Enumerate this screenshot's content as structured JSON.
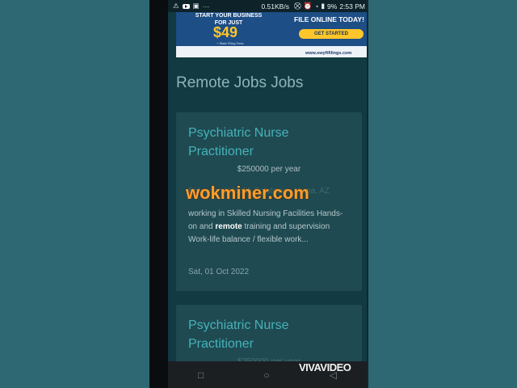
{
  "status_bar": {
    "speed": "0.51KB/s",
    "battery": "9%",
    "time": "2:53 PM"
  },
  "ad": {
    "line1": "START YOUR BUSINESS",
    "line2": "FOR JUST",
    "price": "$49",
    "fine_print": "+ State Filing Fees",
    "cta_title": "FILE ONLINE TODAY!",
    "cta_button": "GET STARTED",
    "url": "www.swyftfilings.com",
    "colors": {
      "background": "#1d4e86",
      "accent": "#ffc62b"
    }
  },
  "page": {
    "heading": "Remote Jobs Jobs"
  },
  "jobs": [
    {
      "title": "Psychiatric Nurse Practitioner",
      "salary": "$250000 per year",
      "company": "Behavioral Health Solutions · Yuma, AZ",
      "desc_prefix": "working in Skilled Nursing Facilities Hands-on and ",
      "desc_bold": "remote",
      "desc_suffix": " training and supervision  Work-life balance / flexible work...",
      "date": "Sat, 01 Oct 2022"
    },
    {
      "title": "Psychiatric Nurse Practitioner",
      "salary": "$250000 per year"
    }
  ],
  "watermark": "wokminer.com",
  "overlay_brand": "VIVAVIDEO",
  "nav": {
    "back_icon": "square-outline",
    "home_icon": "circle-outline",
    "recents_icon": "triangle-outline"
  },
  "colors": {
    "outer_background": "#2e6872",
    "page_background": "#113a42",
    "card_background": "#1f4a52",
    "title_color": "#46b3b8",
    "watermark_color": "#ff9d2a"
  }
}
